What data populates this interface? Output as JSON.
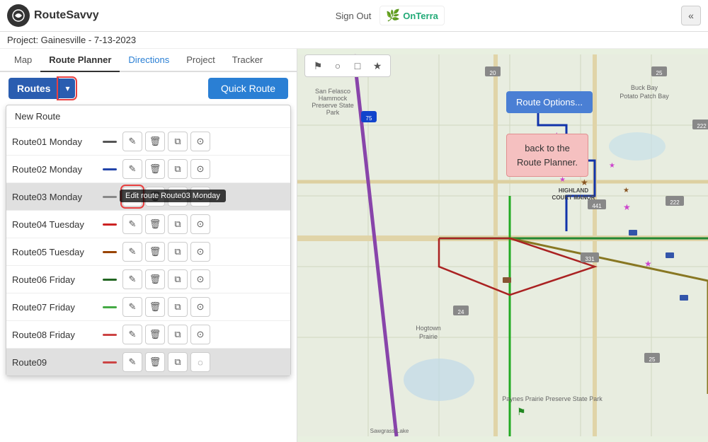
{
  "header": {
    "logo_text": "RouteSavvy",
    "sign_out_label": "Sign Out",
    "onterra_label": "OnTerra",
    "collapse_icon": "«"
  },
  "project": {
    "label": "Project: Gainesville - 7-13-2023"
  },
  "nav_tabs": [
    {
      "id": "map",
      "label": "Map",
      "active": false
    },
    {
      "id": "route-planner",
      "label": "Route Planner",
      "active": true
    },
    {
      "id": "directions",
      "label": "Directions",
      "active": false,
      "blue": true
    },
    {
      "id": "project",
      "label": "Project",
      "active": false
    },
    {
      "id": "tracker",
      "label": "Tracker",
      "active": false
    }
  ],
  "routes_btn": "Routes",
  "quick_route_btn": "Quick Route",
  "new_route_label": "New Route",
  "routes": [
    {
      "name": "Route01 Monday",
      "color": "#555555",
      "selected": false
    },
    {
      "name": "Route02 Monday",
      "color": "#2244aa",
      "selected": false
    },
    {
      "name": "Route03 Monday",
      "color": "#888888",
      "selected": true
    },
    {
      "name": "Route04 Tuesday",
      "color": "#cc2222",
      "selected": false
    },
    {
      "name": "Route05 Tuesday",
      "color": "#994400",
      "selected": false
    },
    {
      "name": "Route06 Friday",
      "color": "#226622",
      "selected": false
    },
    {
      "name": "Route07 Friday",
      "color": "#44aa44",
      "selected": false
    },
    {
      "name": "Route08 Friday",
      "color": "#cc4444",
      "selected": false
    },
    {
      "name": "Route09",
      "color": "#cc4444",
      "selected": false,
      "last": true
    }
  ],
  "tooltip_text": "Edit route Route03 Monday",
  "route_options_label": "ute Options...",
  "back_to_label": "ack to the\nRoute Planner.",
  "map_tools": [
    "flag-icon",
    "circle-icon",
    "square-icon",
    "star-icon"
  ]
}
